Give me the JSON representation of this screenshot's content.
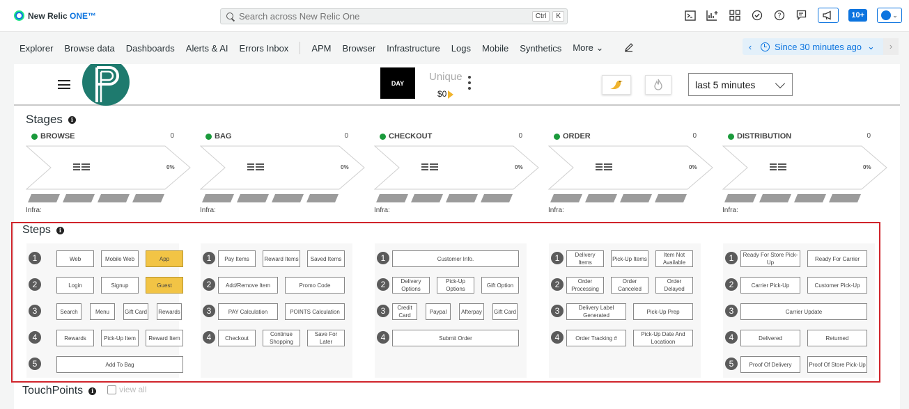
{
  "topbar": {
    "brand": "New Relic",
    "brand_one": "ONE™",
    "search_placeholder": "Search across New Relic One",
    "kbd_ctrl": "Ctrl",
    "kbd_k": "K",
    "badge": "10+"
  },
  "nav": {
    "items": [
      "Explorer",
      "Browse data",
      "Dashboards",
      "Alerts & AI",
      "Errors Inbox"
    ],
    "items2": [
      "APM",
      "Browser",
      "Infrastructure",
      "Logs",
      "Mobile",
      "Synthetics",
      "More ⌄"
    ],
    "time": "Since 30 minutes ago"
  },
  "app": {
    "day": "DAY",
    "unique": "Unique",
    "unique_value": "$0",
    "time_select": "last 5 minutes"
  },
  "stages_title": "Stages",
  "stages": [
    {
      "name": "BROWSE",
      "count": "0",
      "pct": "0%",
      "infra": "Infra:"
    },
    {
      "name": "BAG",
      "count": "0",
      "pct": "0%",
      "infra": "Infra:"
    },
    {
      "name": "CHECKOUT",
      "count": "0",
      "pct": "0%",
      "infra": "Infra:"
    },
    {
      "name": "ORDER",
      "count": "0",
      "pct": "0%",
      "infra": "Infra:"
    },
    {
      "name": "DISTRIBUTION",
      "count": "0",
      "pct": "0%",
      "infra": "Infra:"
    }
  ],
  "steps_title": "Steps",
  "steps": {
    "browse": [
      [
        "Web",
        "Mobile Web",
        "App"
      ],
      [
        "Login",
        "Signup",
        "Guest"
      ],
      [
        "Search",
        "Menu",
        "Gift Card",
        "Rewards"
      ],
      [
        "Rewards",
        "Pick-Up Item",
        "Reward Item"
      ],
      [
        "Add To Bag"
      ]
    ],
    "bag": [
      [
        "Pay Items",
        "Reward Items",
        "Saved Items"
      ],
      [
        "Add/Remove Item",
        "Promo Code"
      ],
      [
        "PAY Calculation",
        "POINTS Calculation"
      ],
      [
        "Checkout",
        "Continue Shopping",
        "Save For Later"
      ]
    ],
    "checkout": [
      [
        "Customer Info."
      ],
      [
        "Delivery Options",
        "Pick-Up Options",
        "Gift Option"
      ],
      [
        "Credit Card",
        "Paypal",
        "Afterpay",
        "Gift Card"
      ],
      [
        "Submit Order"
      ]
    ],
    "order": [
      [
        "Delivery Items",
        "Pick-Up Items",
        "Item Not Available"
      ],
      [
        "Order Processing",
        "Order Canceled",
        "Order Delayed"
      ],
      [
        "Delivery Label Generated",
        "Pick-Up Prep"
      ],
      [
        "Order Tracking #",
        "Pick-Up Date And Locatioon"
      ]
    ],
    "distribution": [
      [
        "Ready For Store Pick-Up",
        "Ready For Carrier"
      ],
      [
        "Carrier Pick-Up",
        "Customer Pick-Up"
      ],
      [
        "Carrier Update"
      ],
      [
        "Delivered",
        "Returned"
      ],
      [
        "Proof Of Delivery",
        "Proof Of Store Pick-Up"
      ]
    ]
  },
  "step_numbers": [
    "1",
    "2",
    "3",
    "4",
    "5"
  ],
  "touchpoints_title": "TouchPoints",
  "view_all": "view all",
  "colors": {
    "accent": "#0c74df",
    "highlight": "#f2c445",
    "alert_border": "#d0242b",
    "status_green": "#1a9a3b"
  }
}
